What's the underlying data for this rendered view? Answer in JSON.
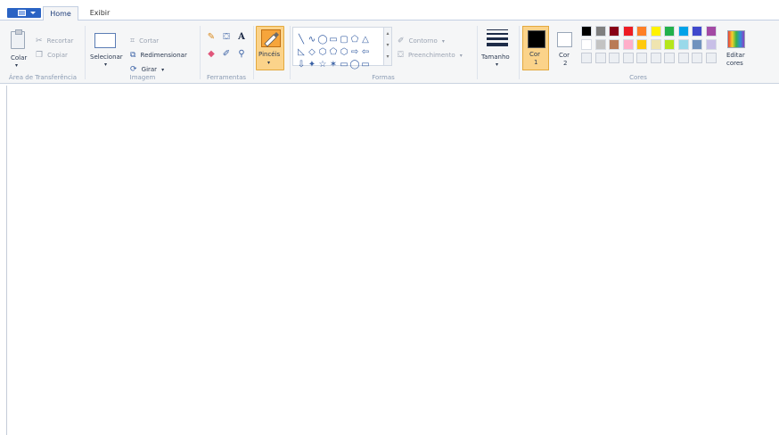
{
  "tabs": {
    "file_icon": "paint-menu-icon",
    "home": "Home",
    "view": "Exibir"
  },
  "clipboard": {
    "paste": "Colar",
    "cut": "Recortar",
    "copy": "Copiar",
    "label": "Área de Transferência"
  },
  "image": {
    "select": "Selecionar",
    "crop": "Cortar",
    "resize": "Redimensionar",
    "rotate": "Girar",
    "label": "Imagem"
  },
  "tools": {
    "label": "Ferramentas",
    "pencil_icon": "pencil-icon",
    "fill_icon": "fill-icon",
    "text_glyph": "A",
    "eraser_icon": "eraser-icon",
    "picker_icon": "color-picker-icon",
    "magnifier_icon": "magnifier-icon"
  },
  "brushes": {
    "label": "Pincéis"
  },
  "shapes": {
    "label": "Formas",
    "row1": [
      "╲",
      "∿",
      "◯",
      "▭",
      "▢",
      "⬠",
      "△"
    ],
    "row2": [
      "◺",
      "◇",
      "⬡",
      "⬠",
      "⬡",
      "⇨",
      "⇦"
    ],
    "row3": [
      "⇩",
      "✦",
      "☆",
      "✶",
      "▭",
      "◯",
      "▭"
    ],
    "outline": "Contorno",
    "fill": "Preenchimento"
  },
  "size": {
    "label": "Tamanho"
  },
  "colors": {
    "color1_line1": "Cor",
    "color1_line2": "1",
    "color2_line1": "Cor",
    "color2_line2": "2",
    "edit_line1": "Editar",
    "edit_line2": "cores",
    "label": "Cores",
    "color1_value": "#000000",
    "color2_value": "#ffffff",
    "palette_row1": [
      "#000000",
      "#7f7f7f",
      "#880015",
      "#ed1c24",
      "#ff7f27",
      "#fff200",
      "#22b14c",
      "#00a2e8",
      "#3f48cc",
      "#a349a4"
    ],
    "palette_row2": [
      "#ffffff",
      "#c3c3c3",
      "#b97a57",
      "#ffaec9",
      "#ffc90e",
      "#efe4b0",
      "#b5e61d",
      "#99d9ea",
      "#7092be",
      "#c8bfe7"
    ]
  }
}
